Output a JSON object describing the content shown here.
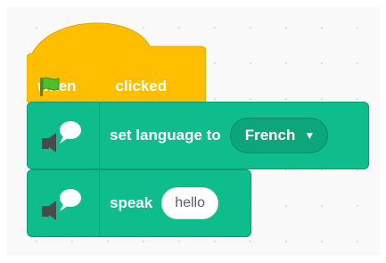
{
  "hat_block": {
    "before_flag": "when",
    "after_flag": "clicked",
    "color": "#ffbf00"
  },
  "set_language_block": {
    "label": "set language to",
    "dropdown_value": "French",
    "color": "#0fbd8c"
  },
  "speak_block": {
    "label": "speak",
    "input_value": "hello"
  },
  "icons": [
    "green-flag-icon",
    "speaker-bubble-icon",
    "dropdown-caret-icon"
  ]
}
